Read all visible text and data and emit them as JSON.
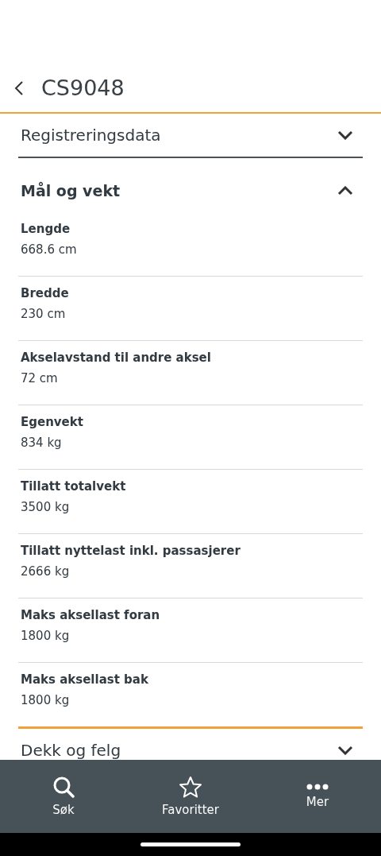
{
  "header": {
    "title": "CS9048"
  },
  "sections": [
    {
      "title": "Registreringsdata",
      "expanded": false
    },
    {
      "title": "Mål og vekt",
      "expanded": true,
      "rows": [
        {
          "label": "Lengde",
          "value": "668.6 cm"
        },
        {
          "label": "Bredde",
          "value": "230 cm"
        },
        {
          "label": "Akselavstand til andre aksel",
          "value": "72 cm"
        },
        {
          "label": "Egenvekt",
          "value": "834 kg"
        },
        {
          "label": "Tillatt totalvekt",
          "value": "3500 kg"
        },
        {
          "label": "Tillatt nyttelast inkl. passasjerer",
          "value": "2666 kg"
        },
        {
          "label": "Maks aksellast foran",
          "value": "1800 kg"
        },
        {
          "label": "Maks aksellast bak",
          "value": "1800 kg"
        }
      ]
    },
    {
      "title": "Dekk og felg",
      "expanded": false
    }
  ],
  "nav": [
    {
      "label": "Søk",
      "kind": "search"
    },
    {
      "label": "Favoritter",
      "kind": "star"
    },
    {
      "label": "Mer",
      "kind": "more"
    }
  ]
}
